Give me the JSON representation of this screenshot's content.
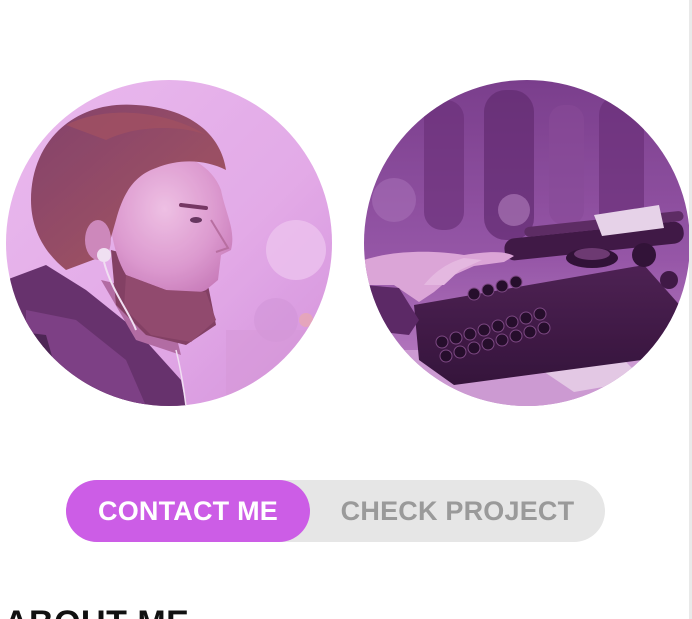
{
  "images": {
    "portrait": {
      "alt": "Man with beard wearing earphones, purple tint",
      "tint": "#c774d6"
    },
    "typewriter": {
      "alt": "Hands typing on a vintage typewriter, purple tint",
      "tint": "#7a3f8e"
    }
  },
  "actions": {
    "contact_label": "CONTACT ME",
    "project_label": "CHECK PROJECT"
  },
  "about": {
    "heading": "ABOUT ME"
  },
  "colors": {
    "accent": "#cc5de6",
    "button_track": "#e6e6e6",
    "secondary_text": "#9a9a9a"
  }
}
